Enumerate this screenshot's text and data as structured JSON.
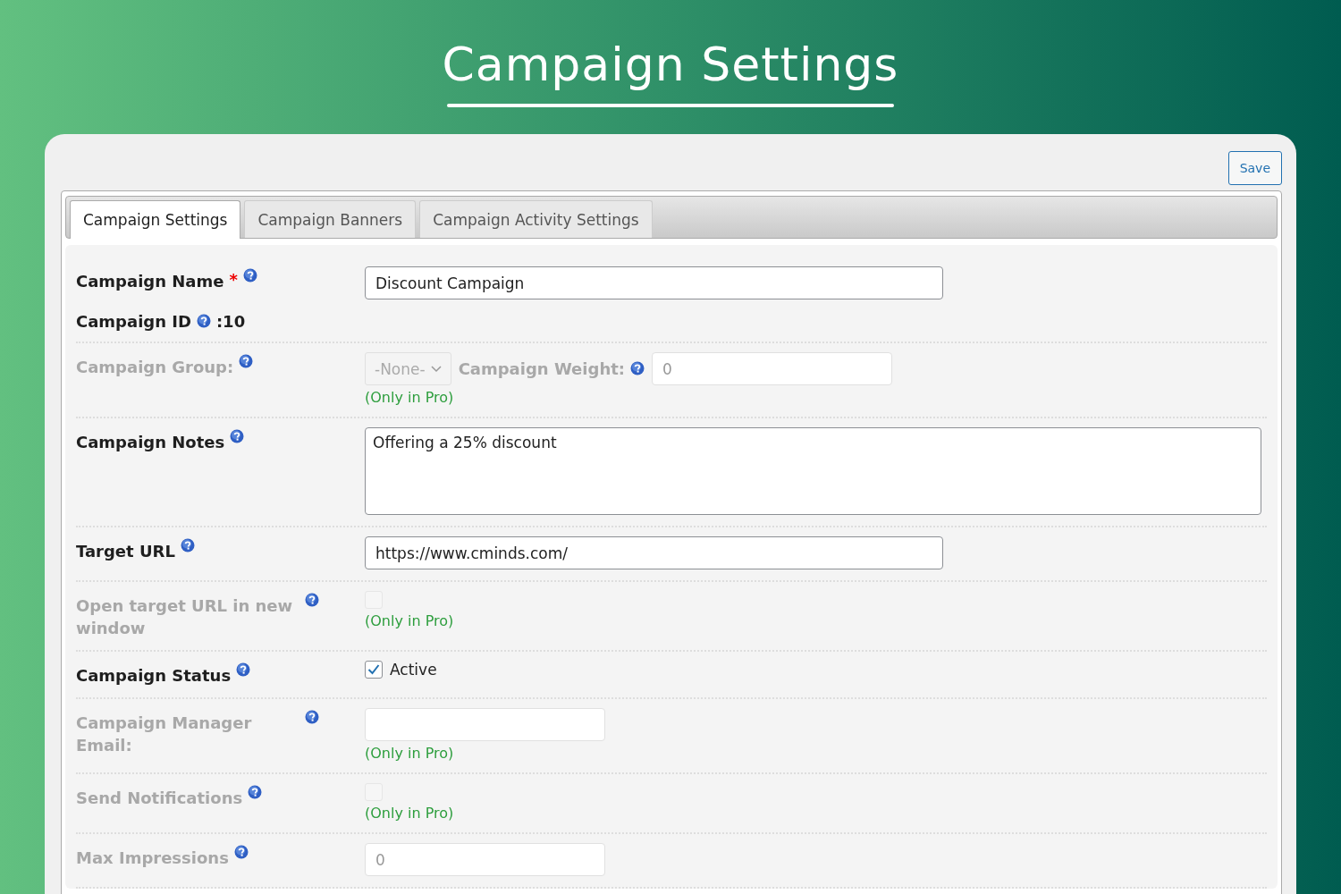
{
  "header": {
    "title": "Campaign Settings"
  },
  "save_button": "Save",
  "tabs": [
    {
      "label": "Campaign Settings",
      "selected": true
    },
    {
      "label": "Campaign Banners",
      "selected": false
    },
    {
      "label": "Campaign Activity Settings",
      "selected": false
    }
  ],
  "rows": [
    {
      "kind": "name",
      "label": "Campaign Name",
      "required": true,
      "required_mark": "*",
      "value": "Discount Campaign",
      "id_label": "Campaign ID",
      "id_value": ":10"
    },
    {
      "kind": "group",
      "label": "Campaign Group:",
      "disabled": true,
      "select_value": "-None-",
      "weight_label": "Campaign Weight:",
      "weight_value": "0",
      "note": "(Only in Pro)"
    },
    {
      "kind": "textarea",
      "label": "Campaign Notes",
      "disabled": false,
      "value": "Offering a 25% discount"
    },
    {
      "kind": "text",
      "label": "Target URL",
      "disabled": false,
      "value": "https://www.cminds.com/"
    },
    {
      "kind": "checkbox",
      "label": "Open target URL in new window",
      "disabled": true,
      "checked": false,
      "note": "(Only in Pro)"
    },
    {
      "kind": "checkbox",
      "label": "Campaign Status",
      "disabled": false,
      "checked": true,
      "checkbox_label": "Active"
    },
    {
      "kind": "text",
      "label": "Campaign Manager Email:",
      "disabled": true,
      "note": "(Only in Pro)"
    },
    {
      "kind": "checkbox",
      "label": "Send Notifications",
      "disabled": true,
      "checked": false,
      "note": "(Only in Pro)"
    },
    {
      "kind": "text",
      "label": "Max Impressions",
      "disabled": true,
      "value": "0"
    }
  ]
}
